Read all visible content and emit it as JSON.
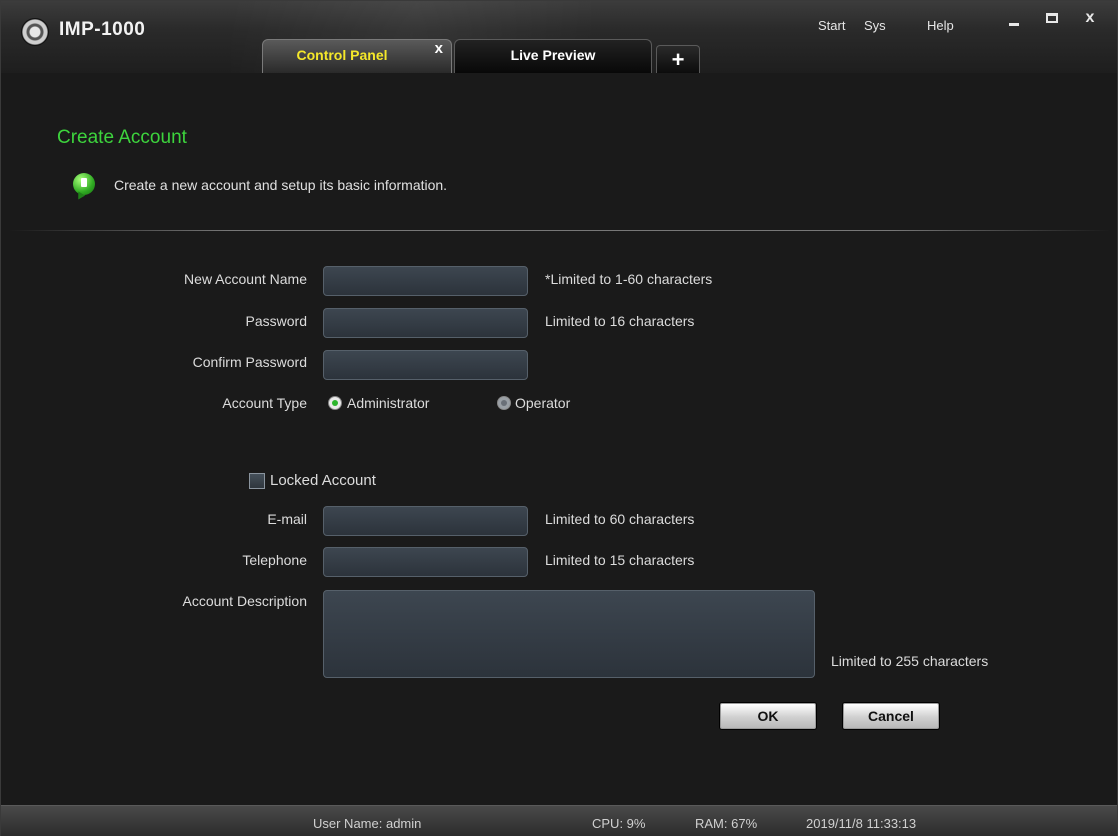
{
  "app": {
    "title": "IMP-1000",
    "logo_icon": "camera-lens-icon"
  },
  "tabs": [
    {
      "label": "Control Panel",
      "active": true,
      "close": "x"
    },
    {
      "label": "Live Preview",
      "active": false
    }
  ],
  "add_tab": "+",
  "top_menu": {
    "start": "Start",
    "sys": "Sys",
    "help": "Help"
  },
  "window_controls": {
    "close": "x"
  },
  "page": {
    "heading": "Create Account",
    "info_text": "Create a new account and setup its basic information."
  },
  "form": {
    "new_account_name": {
      "label": "New Account Name",
      "value": "",
      "hint": "*Limited to 1-60 characters"
    },
    "password": {
      "label": "Password",
      "value": "",
      "hint": "Limited to 16 characters"
    },
    "confirm_password": {
      "label": "Confirm Password",
      "value": ""
    },
    "account_type": {
      "label": "Account Type",
      "options": [
        "Administrator",
        "Operator"
      ],
      "selected": "Administrator"
    },
    "locked_account": {
      "label": "Locked Account",
      "checked": false
    },
    "email": {
      "label": "E-mail",
      "value": "",
      "hint": "Limited to 60 characters"
    },
    "telephone": {
      "label": "Telephone",
      "value": "",
      "hint": "Limited to 15 characters"
    },
    "description": {
      "label": "Account Description",
      "value": "",
      "hint": "Limited to 255 characters"
    }
  },
  "buttons": {
    "ok": "OK",
    "cancel": "Cancel"
  },
  "status_bar": {
    "user": "User Name: admin",
    "cpu": "CPU: 9%",
    "ram": "RAM: 67%",
    "datetime": "2019/11/8 11:33:13"
  },
  "colors": {
    "accent_green": "#3dd43d",
    "active_tab_text": "#f5e82a",
    "background": "#1a1a1a"
  }
}
